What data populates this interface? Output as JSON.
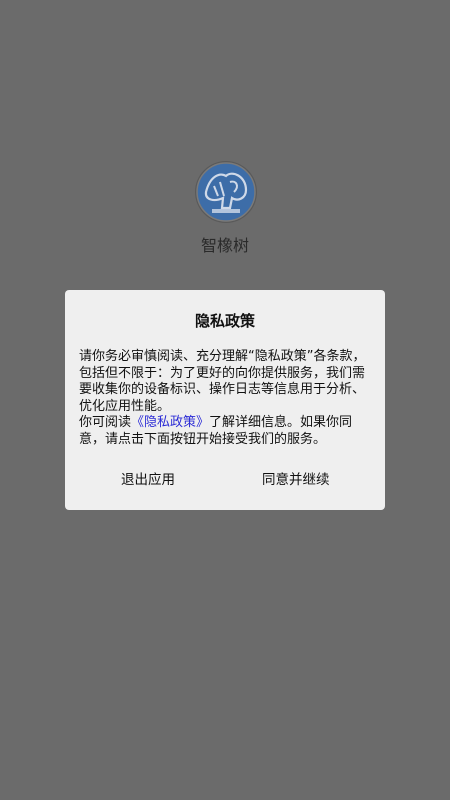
{
  "app": {
    "name": "智橡树"
  },
  "dialog": {
    "title": "隐私政策",
    "paragraph1": "请你务必审慎阅读、充分理解“隐私政策”各条款，包括但不限于：为了更好的向你提供服务，我们需要收集你的设备标识、操作日志等信息用于分析、优化应用性能。",
    "paragraph2_prefix": "你可阅读",
    "policy_link": "《隐私政策》",
    "paragraph2_suffix": "了解详细信息。如果你同意，请点击下面按钮开始接受我们的服务。",
    "exit_button": "退出应用",
    "agree_button": "同意并继续"
  },
  "colors": {
    "backdrop": "#6b6b6b",
    "dialog_bg": "#efefef",
    "link": "#2c2cd6",
    "logo": "#3d6da8"
  }
}
